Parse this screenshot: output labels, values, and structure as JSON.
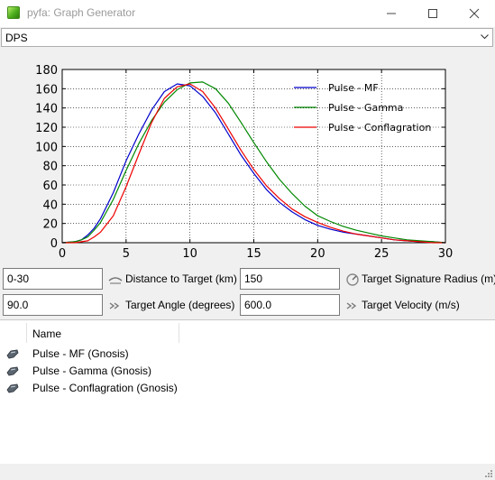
{
  "window": {
    "title": "pyfa: Graph Generator",
    "icons": {
      "app": "pyfa-app-icon",
      "minimize": "minimize-icon",
      "maximize": "maximize-icon",
      "close": "close-icon"
    }
  },
  "graph_select": {
    "value": "DPS",
    "icon": "chevron-down-icon"
  },
  "chart_data": {
    "type": "line",
    "title": "",
    "xlabel": "",
    "ylabel": "",
    "xlim": [
      0,
      30
    ],
    "ylim": [
      0,
      180
    ],
    "xticks": [
      "0",
      "5",
      "10",
      "15",
      "20",
      "25",
      "30"
    ],
    "yticks": [
      "0",
      "20",
      "40",
      "60",
      "80",
      "100",
      "120",
      "140",
      "160",
      "180"
    ],
    "grid": true,
    "legend_position": "top-right",
    "series": [
      {
        "name": "Pulse - MF",
        "color": "#0000cc",
        "x": [
          0,
          1,
          1.5,
          2,
          2.5,
          3,
          4,
          5,
          6,
          7,
          8,
          9,
          10,
          11,
          12,
          13,
          14,
          15,
          16,
          17,
          18,
          19,
          20,
          21,
          22,
          23,
          24,
          25,
          26,
          27,
          28,
          29,
          30
        ],
        "y": [
          0,
          1,
          3,
          8,
          15,
          25,
          52,
          85,
          113,
          138,
          157,
          165,
          163,
          152,
          135,
          113,
          91,
          72,
          55,
          42,
          32,
          24,
          18,
          14,
          11,
          9,
          7,
          5,
          3,
          2,
          1,
          1,
          0
        ]
      },
      {
        "name": "Pulse - Gamma",
        "color": "#008800",
        "x": [
          0,
          1,
          1.5,
          2,
          2.5,
          3,
          4,
          5,
          6,
          7,
          8,
          9,
          10,
          11,
          12,
          13,
          14,
          15,
          16,
          17,
          18,
          19,
          20,
          21,
          22,
          23,
          24,
          25,
          26,
          27,
          28,
          29,
          30
        ],
        "y": [
          0,
          1,
          3,
          6,
          13,
          21,
          45,
          75,
          103,
          127,
          146,
          159,
          166,
          167,
          160,
          145,
          125,
          104,
          84,
          66,
          51,
          38,
          28,
          22,
          17,
          13,
          10,
          7,
          5,
          3,
          2,
          1,
          0
        ]
      },
      {
        "name": "Pulse - Conflagration",
        "color": "#ee0000",
        "x": [
          0,
          1,
          1.5,
          2,
          2.5,
          3,
          4,
          5,
          6,
          7,
          8,
          9,
          10,
          11,
          12,
          13,
          14,
          15,
          16,
          17,
          18,
          19,
          20,
          21,
          22,
          23,
          24,
          25,
          26,
          27,
          28,
          29,
          30
        ],
        "y": [
          0,
          0,
          1,
          2,
          6,
          11,
          28,
          58,
          92,
          125,
          150,
          162,
          165,
          157,
          140,
          118,
          96,
          76,
          59,
          46,
          35,
          27,
          21,
          16,
          12,
          9,
          7,
          5,
          3,
          2,
          1,
          0,
          0
        ]
      }
    ]
  },
  "fields": {
    "distance": {
      "value": "0-30",
      "label": "Distance to Target (km)",
      "icon": "distance-icon"
    },
    "signature": {
      "value": "150",
      "label": "Target Signature Radius (m)",
      "icon": "signature-radius-icon"
    },
    "angle": {
      "value": "90.0",
      "label": "Target Angle (degrees)",
      "icon": "angle-icon"
    },
    "velocity": {
      "value": "600.0",
      "label": "Target Velocity (m/s)",
      "icon": "velocity-icon"
    }
  },
  "list": {
    "column_name": "Name",
    "rows": [
      {
        "label": "Pulse - MF (Gnosis)",
        "icon": "ship-fit-icon"
      },
      {
        "label": "Pulse - Gamma (Gnosis)",
        "icon": "ship-fit-icon"
      },
      {
        "label": "Pulse - Conflagration (Gnosis)",
        "icon": "ship-fit-icon"
      }
    ]
  },
  "colors": {
    "mf": "#0000cc",
    "gamma": "#008800",
    "conflagration": "#ee0000"
  }
}
